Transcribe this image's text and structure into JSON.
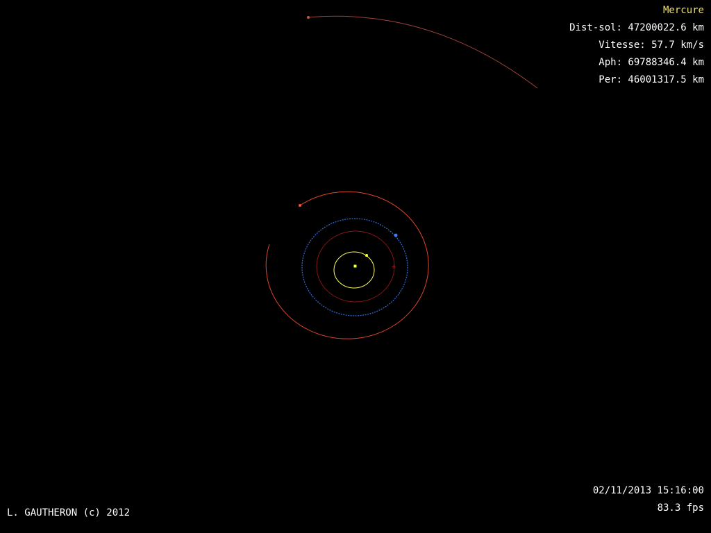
{
  "info": {
    "planet": "Mercure",
    "distance": "Dist-sol: 47200022.6 km",
    "speed": "Vitesse: 57.7 km/s",
    "aphelion": "Aph: 69788346.4 km",
    "perihelion": "Per: 46001317.5 km"
  },
  "footer": {
    "datetime": "02/11/2013 15:16:00",
    "fps": "83.3 fps",
    "credit": "L. GAUTHERON (c) 2012"
  },
  "colors": {
    "background": "#000000",
    "sun": "#ffff33",
    "mercury_orbit": "#ffff66",
    "venus_orbit": "#8a1515",
    "earth_orbit": "#2f6fe0",
    "mars_orbit": "#e0452c",
    "outer_orbit": "#a0453a",
    "text": "#ffffff",
    "planet_label": "#e8e070"
  }
}
